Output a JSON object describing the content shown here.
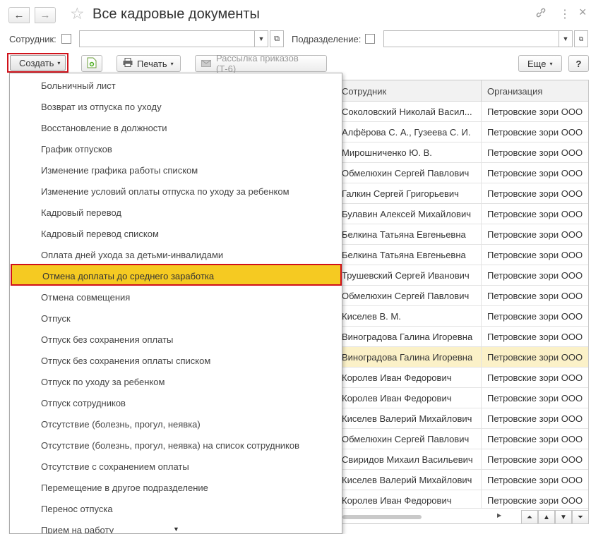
{
  "window": {
    "title": "Все кадровые документы",
    "back_icon": "←",
    "forward_icon": "→",
    "star_icon": "☆",
    "link_icon": "🔗",
    "more_icon": "⋮",
    "close_icon": "×"
  },
  "filters": {
    "employee_label": "Сотрудник:",
    "employee_value": "",
    "department_label": "Подразделение:",
    "department_value": "",
    "dropdown_icon": "▼",
    "open_icon": "⧉"
  },
  "toolbar": {
    "create_label": "Создать",
    "print_label": "Печать",
    "mailing_label": "Рассылка приказов (Т-6)",
    "more_label": "Еще",
    "help_label": "?",
    "caret": "▾"
  },
  "table": {
    "columns": [
      "Сотрудник",
      "Организация"
    ],
    "rows": [
      {
        "employee": "Соколовский Николай Васил...",
        "org": "Петровские зори ООО"
      },
      {
        "employee": "Алфёрова С. А., Гузеева С. И.",
        "org": "Петровские зори ООО"
      },
      {
        "employee": "Мирошниченко Ю. В.",
        "org": "Петровские зори ООО"
      },
      {
        "employee": "Обмелюхин Сергей Павлович",
        "org": "Петровские зори ООО"
      },
      {
        "employee": "Галкин Сергей Григорьевич",
        "org": "Петровские зори ООО"
      },
      {
        "employee": "Булавин Алексей Михайлович",
        "org": "Петровские зори ООО"
      },
      {
        "employee": "Белкина Татьяна Евгеньевна",
        "org": "Петровские зори ООО"
      },
      {
        "employee": "Белкина Татьяна Евгеньевна",
        "org": "Петровские зори ООО"
      },
      {
        "employee": "Трушевский Сергей Иванович",
        "org": "Петровские зори ООО"
      },
      {
        "employee": "Обмелюхин Сергей Павлович",
        "org": "Петровские зори ООО"
      },
      {
        "employee": "Киселев В. М.",
        "org": "Петровские зори ООО"
      },
      {
        "employee": "Виноградова Галина Игоревна",
        "org": "Петровские зори ООО"
      },
      {
        "employee": "Виноградова Галина Игоревна",
        "org": "Петровские зори ООО",
        "selected": true
      },
      {
        "employee": "Королев Иван Федорович",
        "org": "Петровские зори ООО"
      },
      {
        "employee": "Королев Иван Федорович",
        "org": "Петровские зори ООО"
      },
      {
        "employee": "Киселев Валерий Михайлович",
        "org": "Петровские зори ООО"
      },
      {
        "employee": "Обмелюхин Сергей Павлович",
        "org": "Петровские зори ООО"
      },
      {
        "employee": "Свиридов Михаил Васильевич",
        "org": "Петровские зори ООО"
      },
      {
        "employee": "Киселев Валерий Михайлович",
        "org": "Петровские зори ООО"
      },
      {
        "employee": "Королев Иван Федорович",
        "org": "Петровские зори ООО"
      }
    ],
    "nav": {
      "first": "⏶",
      "up": "▲",
      "down": "▼",
      "last": "⏷",
      "scroll_right": "▶"
    }
  },
  "menu": {
    "items": [
      "Больничный лист",
      "Возврат из отпуска по уходу",
      "Восстановление в должности",
      "График отпусков",
      "Изменение графика работы списком",
      "Изменение условий оплаты отпуска по уходу за ребенком",
      "Кадровый перевод",
      "Кадровый перевод списком",
      "Оплата дней ухода за детьми-инвалидами",
      "Отмена доплаты до среднего заработка",
      "Отмена совмещения",
      "Отпуск",
      "Отпуск без сохранения оплаты",
      "Отпуск без сохранения оплаты списком",
      "Отпуск по уходу за ребенком",
      "Отпуск сотрудников",
      "Отсутствие (болезнь, прогул, неявка)",
      "Отсутствие (болезнь, прогул, неявка) на список сотрудников",
      "Отсутствие с сохранением оплаты",
      "Перемещение в другое подразделение",
      "Перенос отпуска",
      "Прием на работу"
    ],
    "highlighted_index": 9,
    "scroll_down_icon": "▼"
  },
  "colors": {
    "highlight": "#f5ca22",
    "border_red": "#d0121b",
    "selected_row": "#fbf1c8"
  }
}
